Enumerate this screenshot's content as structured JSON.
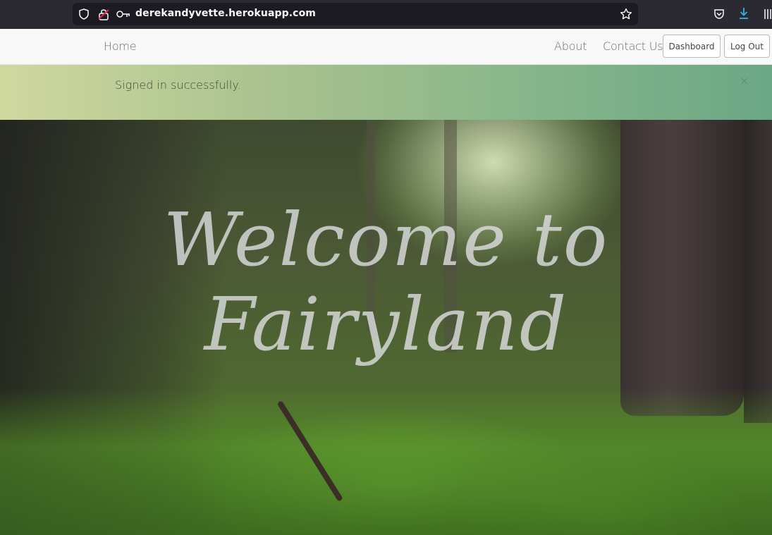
{
  "browser": {
    "url": "derekandyvette.herokuapp.com"
  },
  "nav": {
    "home": "Home",
    "about": "About",
    "contact": "Contact Us",
    "dashboard": "Dashboard",
    "logout": "Log Out"
  },
  "alert": {
    "message": "Signed in successfully.",
    "close": "×"
  },
  "hero": {
    "title_line1": "Welcome to",
    "title_line2": "Fairyland"
  },
  "colors": {
    "alert_gradient_start": "#d0d89e",
    "alert_gradient_end": "#6aa884",
    "download_icon_accent": "#2fb5e8"
  }
}
